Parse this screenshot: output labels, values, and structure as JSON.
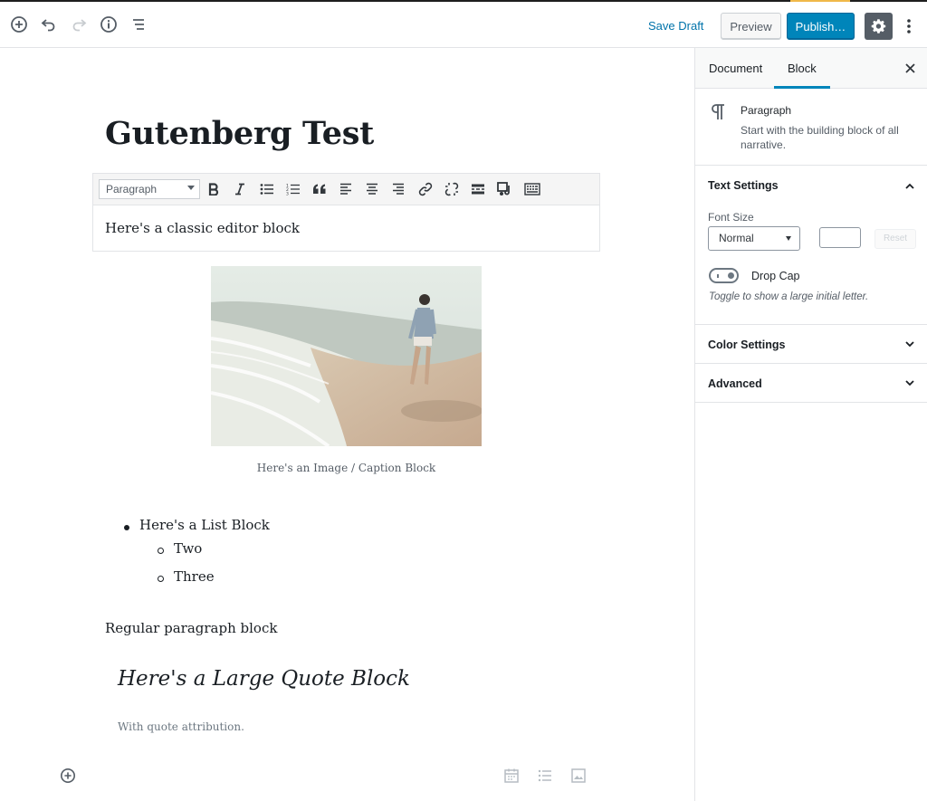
{
  "toolbar": {
    "save_draft_label": "Save Draft",
    "preview_label": "Preview",
    "publish_label": "Publish…"
  },
  "post": {
    "title": "Gutenberg Test",
    "classic_format_value": "Paragraph",
    "classic_text": "Here's a classic editor block",
    "image_caption": "Here's an Image / Caption Block",
    "list_items": [
      "Here's a List Block",
      "Two",
      "Three"
    ],
    "paragraph": "Regular paragraph block",
    "quote_text": "Here's a Large Quote Block",
    "quote_citation": "With quote attribution."
  },
  "sidebar": {
    "tabs": [
      "Document",
      "Block"
    ],
    "active_tab": "Block",
    "block_card": {
      "icon": "paragraph-icon",
      "title": "Paragraph",
      "description": "Start with the building block of all narrative."
    },
    "text_settings": {
      "title": "Text Settings",
      "font_size_label": "Font Size",
      "font_size_value": "Normal",
      "custom_size_value": "",
      "reset_label": "Reset",
      "drop_cap_label": "Drop Cap",
      "drop_cap_help": "Toggle to show a large initial letter."
    },
    "color_settings_title": "Color Settings",
    "advanced_title": "Advanced"
  },
  "colors": {
    "primary": "#0085ba",
    "link": "#0073aa",
    "settings_active": "#555d66"
  }
}
